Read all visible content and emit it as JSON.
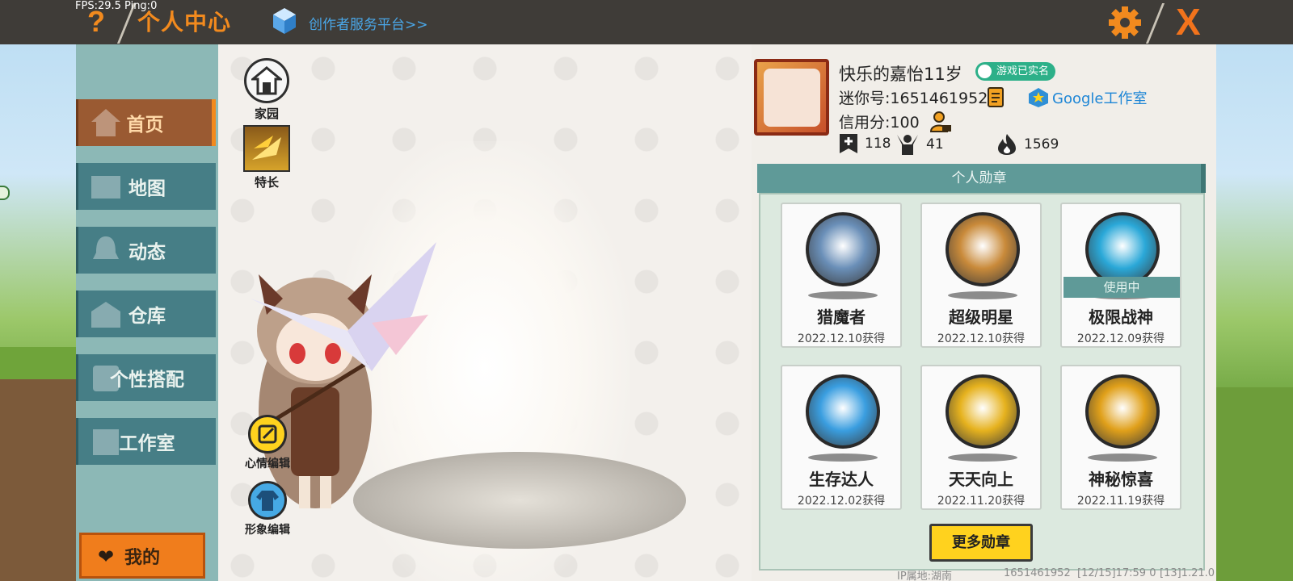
{
  "debug": {
    "fps": "FPS:29.5  Ping:0"
  },
  "header": {
    "help_glyph": "?",
    "title": "个人中心",
    "creator_link": "创作者服务平台>>",
    "close_glyph": "X"
  },
  "sidebar": {
    "items": [
      {
        "label": "首页",
        "icon": "home-icon",
        "active": true
      },
      {
        "label": "地图",
        "icon": "map-icon",
        "active": false
      },
      {
        "label": "动态",
        "icon": "bell-icon",
        "active": false
      },
      {
        "label": "仓库",
        "icon": "warehouse-icon",
        "active": false
      },
      {
        "label": "个性搭配",
        "icon": "outfit-icon",
        "active": false
      },
      {
        "label": "工作室",
        "icon": "studio-icon",
        "active": false
      }
    ],
    "my_label": "我的"
  },
  "stage": {
    "home_label": "家园",
    "talent_label": "特长",
    "mood_label": "心情编辑",
    "appearance_label": "形象编辑"
  },
  "profile": {
    "username": "快乐的嘉怡11岁",
    "verified_label": "游戏已实名",
    "mini_id": "迷你号:1651461952",
    "studio_label": "Google工作室",
    "credit": "信用分:100",
    "stats": {
      "added": "118",
      "fans": "41",
      "heat": "1569"
    }
  },
  "badges": {
    "header": "个人勋章",
    "items": [
      {
        "name": "猎魔者",
        "date": "2022.12.10获得",
        "in_use": false,
        "color": "#6a8fb8"
      },
      {
        "name": "超级明星",
        "date": "2022.12.10获得",
        "in_use": false,
        "color": "#c98a3a"
      },
      {
        "name": "极限战神",
        "date": "2022.12.09获得",
        "in_use": true,
        "in_use_label": "使用中",
        "color": "#2aa8d8"
      },
      {
        "name": "生存达人",
        "date": "2022.12.02获得",
        "in_use": false,
        "color": "#3a9ee0"
      },
      {
        "name": "天天向上",
        "date": "2022.11.20获得",
        "in_use": false,
        "color": "#e6b21e"
      },
      {
        "name": "神秘惊喜",
        "date": "2022.11.19获得",
        "in_use": false,
        "color": "#e0a01a"
      }
    ],
    "more_label": "更多勋章"
  },
  "footer": {
    "ip": "IP属地:湖南",
    "uid": "1651461952",
    "time": "[12/15]17:59 0",
    "build": "[13]1.21.0"
  },
  "colors": {
    "accent": "#f28a1e",
    "teal": "#5f9a98",
    "nav": "#467e86"
  }
}
